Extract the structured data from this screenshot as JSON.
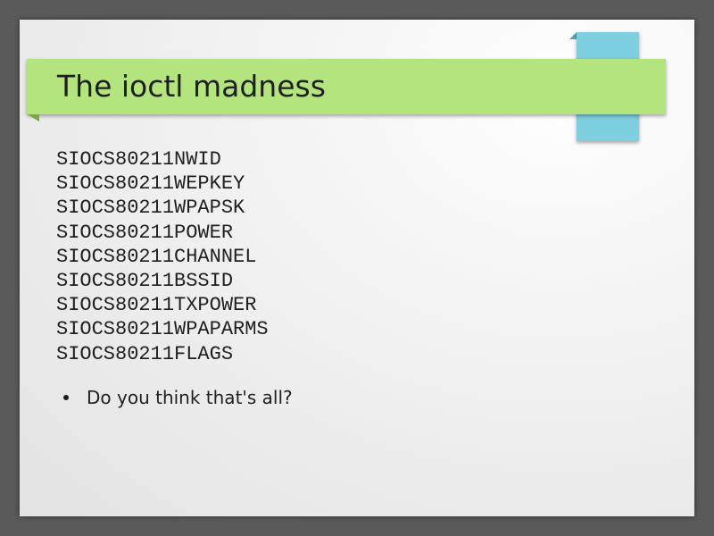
{
  "slide": {
    "title": "The ioctl madness",
    "code_lines": [
      "SIOCS80211NWID",
      "SIOCS80211WEPKEY",
      "SIOCS80211WPAPSK",
      "SIOCS80211POWER",
      "SIOCS80211CHANNEL",
      "SIOCS80211BSSID",
      "SIOCS80211TXPOWER",
      "SIOCS80211WPAPARMS",
      "SIOCS80211FLAGS"
    ],
    "bullets": [
      "Do you think that's all?"
    ]
  },
  "colors": {
    "title_bar": "#b3e47e",
    "accent_block": "#7ecfe0",
    "backdrop": "#5a5a5a",
    "text": "#1f1f1f"
  }
}
